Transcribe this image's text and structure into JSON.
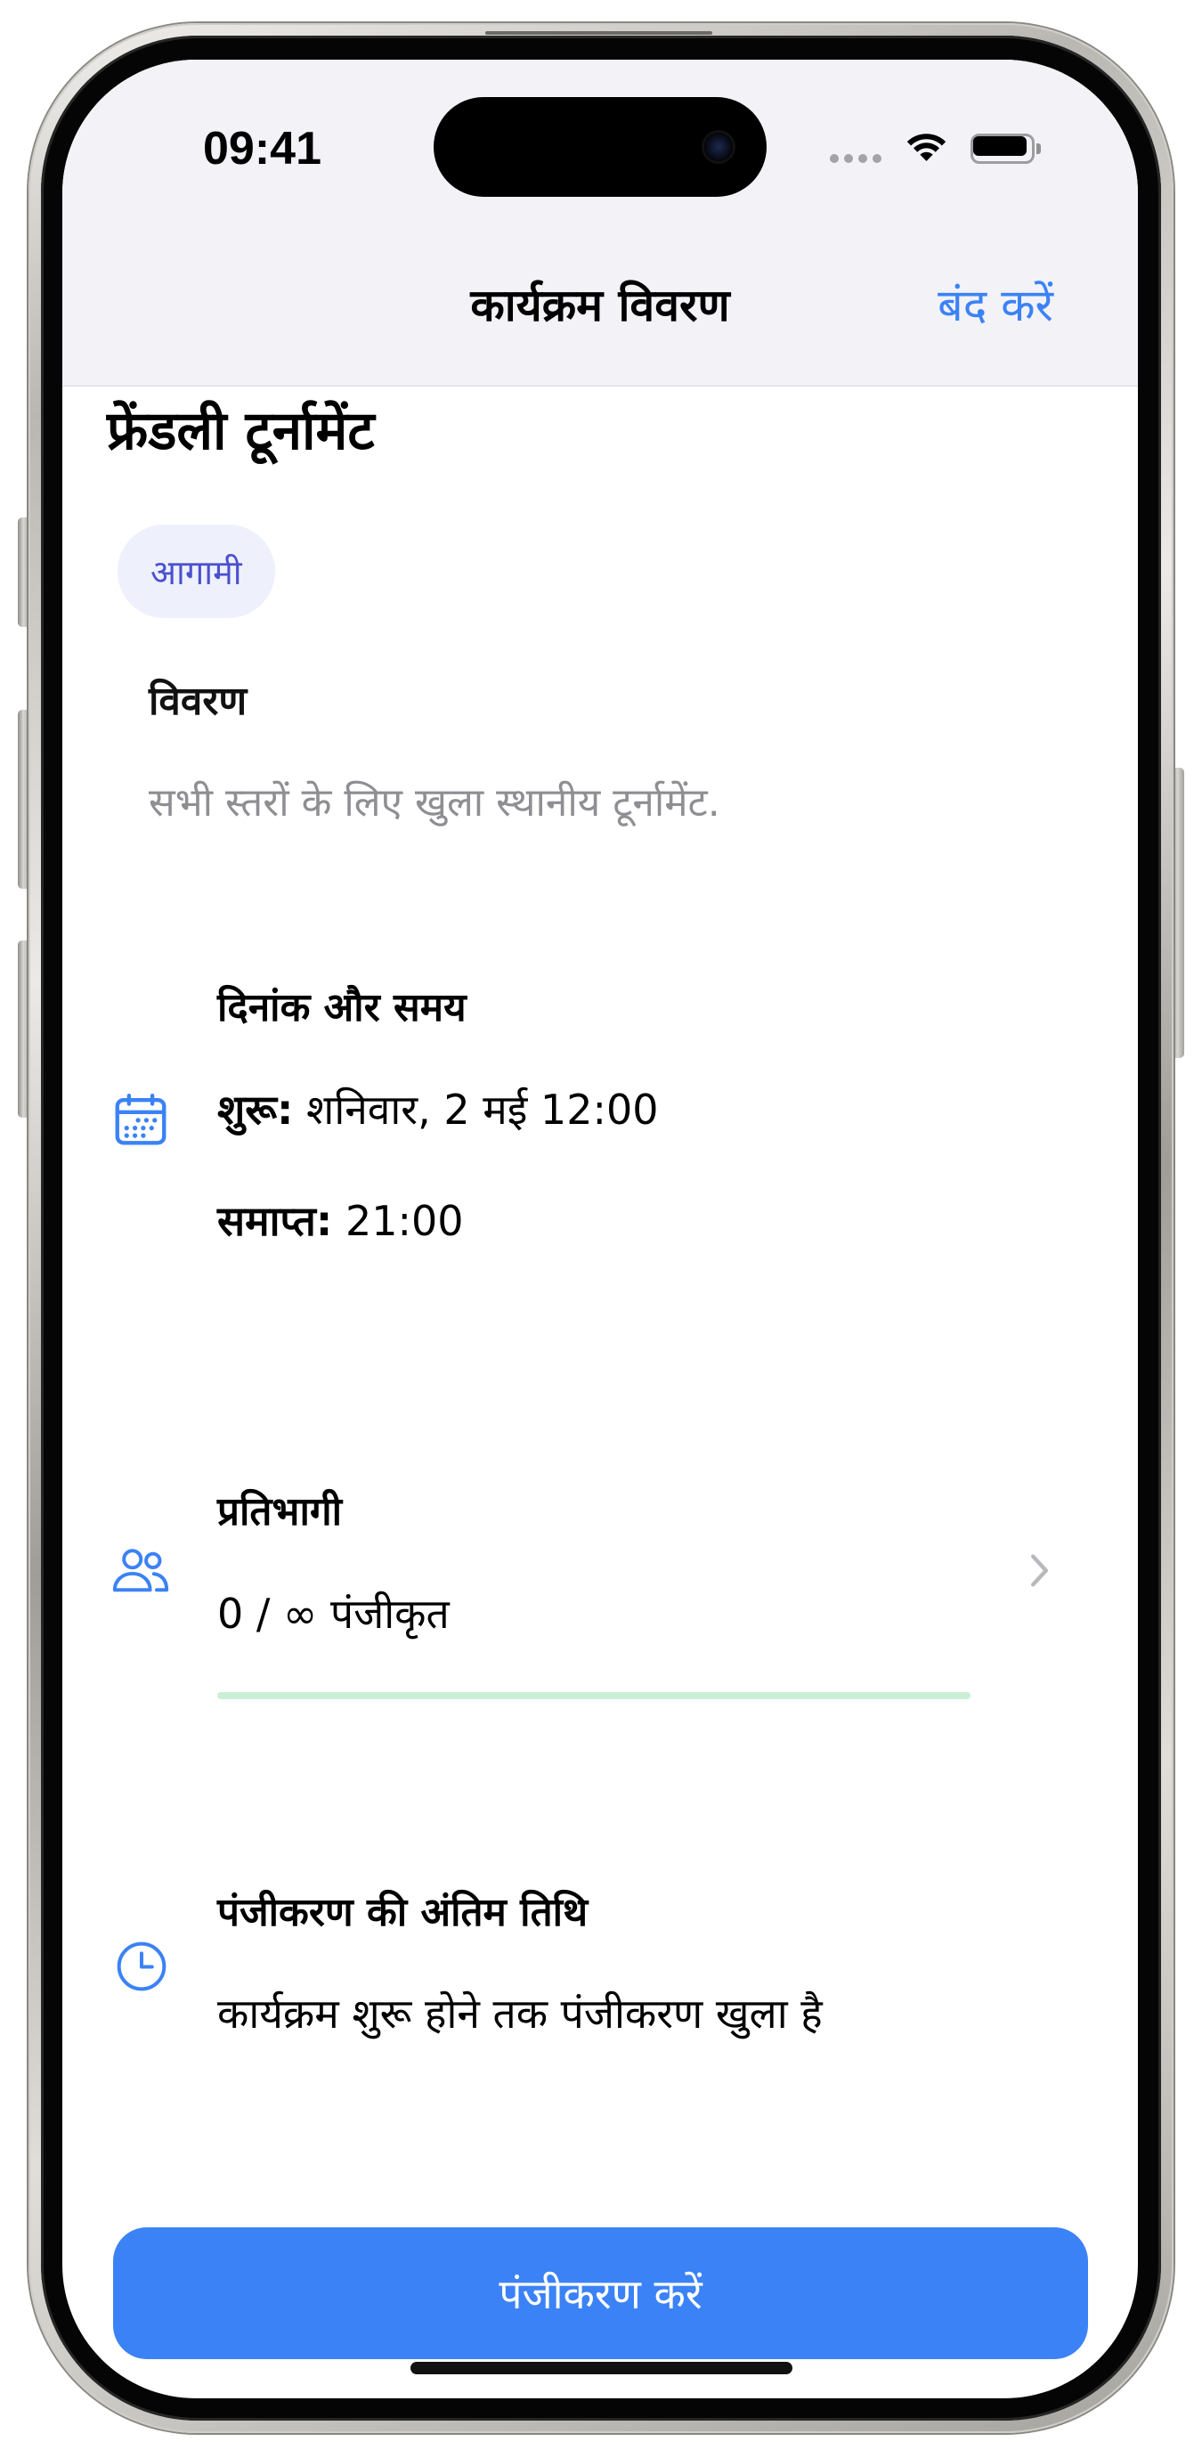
{
  "status_bar": {
    "time": "09:41",
    "signal_strength": 0,
    "battery_level": 1,
    "icons": [
      "signal-icon",
      "wifi-icon",
      "battery-icon"
    ]
  },
  "nav": {
    "title": "कार्यक्रम विवरण",
    "close_label": "बंद करें"
  },
  "event": {
    "title": "फ्रेंडली टूर्नामेंट",
    "status_badge": "आगामी",
    "description_heading": "विवरण",
    "description": "सभी स्तरों के लिए खुला स्थानीय टूर्नामेंट."
  },
  "schedule": {
    "icon": "calendar-icon",
    "heading": "दिनांक और समय",
    "start_label": "शुरू:",
    "start_value": "शनिवार, 2 मई 12:00",
    "end_label": "समाप्त:",
    "end_value": "21:00"
  },
  "participants": {
    "icon": "people-icon",
    "heading": "प्रतिभागी",
    "count_text": "0 / ∞ पंजीकृत",
    "progress": 0,
    "chevron_icon": "chevron-right-icon"
  },
  "deadline": {
    "icon": "clock-icon",
    "heading": "पंजीकरण की अंतिम तिथि",
    "text": "कार्यक्रम शुरू होने तक पंजीकरण खुला है"
  },
  "actions": {
    "register_label": "पंजीकरण करें"
  },
  "colors": {
    "accent": "#3b82f6",
    "nav_bg": "#f2f2f7",
    "badge_bg": "#eef0fc",
    "badge_text": "#4a50cf",
    "secondary_text": "#8e8e93",
    "progress_track": "#c9f0d7",
    "progress_fill": "#34c759",
    "button_text": "#ffffff"
  }
}
